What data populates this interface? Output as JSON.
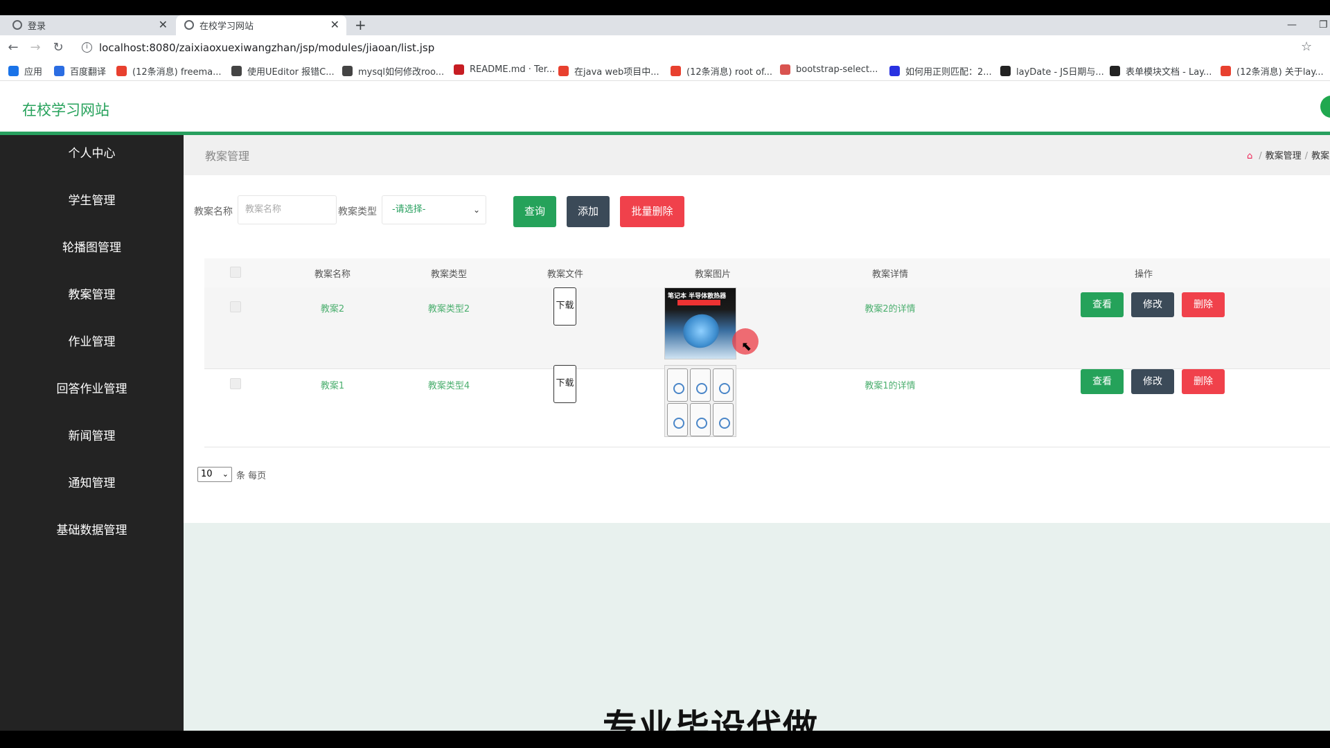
{
  "browser": {
    "tabs": [
      {
        "title": "登录",
        "active": false
      },
      {
        "title": "在校学习网站",
        "active": true
      }
    ],
    "new_tab": "+",
    "url": "localhost:8080/zaixiaoxuexiwangzhan/jsp/modules/jiaoan/list.jsp",
    "bookmarks": [
      {
        "label": "应用",
        "icon": "apps-grid-icon",
        "color": "#1a73e8"
      },
      {
        "label": "百度翻译",
        "icon": "baidu-translate-icon",
        "color": "#2b6de2"
      },
      {
        "label": "(12条消息) freema...",
        "icon": "csdn-icon",
        "color": "#e8402f"
      },
      {
        "label": "使用UEditor 报错C...",
        "icon": "doc-icon",
        "color": "#444"
      },
      {
        "label": "mysql如何修改roo...",
        "icon": "doc-icon",
        "color": "#444"
      },
      {
        "label": "README.md · Ter...",
        "icon": "gitee-icon",
        "color": "#c71d23"
      },
      {
        "label": "在java web项目中...",
        "icon": "csdn-icon",
        "color": "#e8402f"
      },
      {
        "label": "(12条消息) root of...",
        "icon": "csdn-icon",
        "color": "#e8402f"
      },
      {
        "label": "bootstrap-select...",
        "icon": "bootstrap-icon",
        "color": "#d9534f"
      },
      {
        "label": "如何用正则匹配：2...",
        "icon": "baidu-icon",
        "color": "#2932e1"
      },
      {
        "label": "layDate - JS日期与...",
        "icon": "layui-icon",
        "color": "#222"
      },
      {
        "label": "表单模块文档 - Lay...",
        "icon": "layui-icon",
        "color": "#222"
      },
      {
        "label": "(12条消息) 关于lay...",
        "icon": "csdn-icon",
        "color": "#e8402f"
      }
    ]
  },
  "app": {
    "title": "在校学习网站",
    "accent": "#28a05f"
  },
  "sidebar": {
    "items": [
      {
        "label": "个人中心"
      },
      {
        "label": "学生管理"
      },
      {
        "label": "轮播图管理"
      },
      {
        "label": "教案管理"
      },
      {
        "label": "作业管理"
      },
      {
        "label": "回答作业管理"
      },
      {
        "label": "新闻管理"
      },
      {
        "label": "通知管理"
      },
      {
        "label": "基础数据管理"
      }
    ]
  },
  "page": {
    "title": "教案管理",
    "breadcrumb": [
      "教案管理",
      "教案"
    ]
  },
  "search": {
    "name_label": "教案名称",
    "name_placeholder": "教案名称",
    "type_label": "教案类型",
    "type_value": "-请选择-",
    "query_button": "查询",
    "add_button": "添加",
    "batch_delete_button": "批量删除"
  },
  "table": {
    "headers": [
      "教案名称",
      "教案类型",
      "教案文件",
      "教案图片",
      "教案详情",
      "操作"
    ],
    "rows": [
      {
        "name": "教案2",
        "type": "教案类型2",
        "file_button": "下载",
        "image_caption": "笔记本 半导体散热器",
        "detail": "教案2的详情",
        "view": "查看",
        "edit": "修改",
        "delete": "删除"
      },
      {
        "name": "教案1",
        "type": "教案类型4",
        "file_button": "下载",
        "detail": "教案1的详情",
        "view": "查看",
        "edit": "修改",
        "delete": "删除"
      }
    ]
  },
  "pager": {
    "page_size": "10",
    "suffix": "条 每页"
  },
  "overlay_text": "专业毕设代做"
}
